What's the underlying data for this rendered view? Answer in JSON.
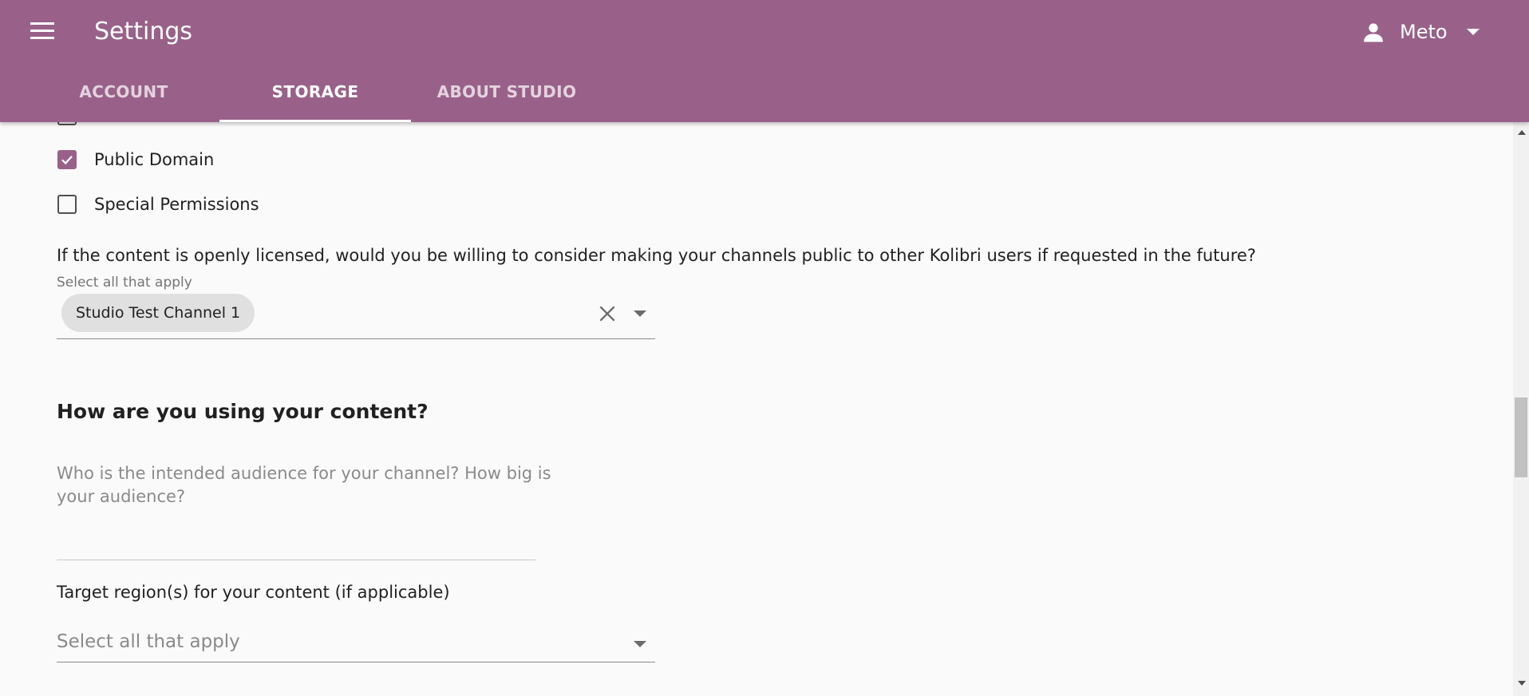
{
  "header": {
    "title": "Settings",
    "user_name": "Meto",
    "tabs": [
      {
        "label": "ACCOUNT"
      },
      {
        "label": "STORAGE"
      },
      {
        "label": "ABOUT STUDIO"
      }
    ],
    "colors": {
      "brand": "#996189"
    }
  },
  "licenses": [
    {
      "label": "Public Domain",
      "checked": true
    },
    {
      "label": "Special Permissions",
      "checked": false
    }
  ],
  "public_question": {
    "text": "If the content is openly licensed, would you be willing to consider making your channels public to other Kolibri users if requested in the future?",
    "hint": "Select all that apply",
    "selected_chips": [
      "Studio Test Channel 1"
    ]
  },
  "usage_section": {
    "heading": "How are you using your content?",
    "audience_placeholder": "Who is the intended audience for your channel? How big is your audience?",
    "target_region_label": "Target region(s) for your content (if applicable)",
    "target_region_placeholder": "Select all that apply"
  },
  "icons": {
    "menu": "menu-icon",
    "user": "person-icon",
    "clear": "close-icon",
    "dropdown": "chevron-down-icon",
    "check": "check-icon"
  }
}
